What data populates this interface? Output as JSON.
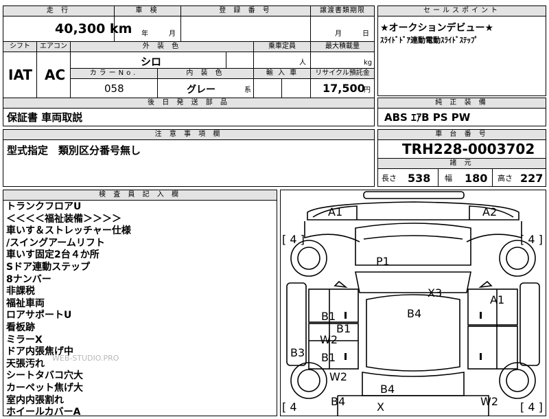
{
  "top_left": {
    "headers": {
      "mileage": "走 行",
      "inspection": "車 検",
      "registration": "登 録 番 号",
      "transfer_deadline": "譲渡書類期限",
      "shift": "シフト",
      "aircon": "エアコン",
      "exterior_color": "外 装 色",
      "capacity": "乗車定員",
      "max_load": "最大積載量",
      "color_no": "カラーNo.",
      "interior_color": "内 装 色",
      "import": "輸 入 車",
      "recycle": "リサイクル預託金",
      "later_parts": "後 日 発 送 部 品",
      "notes": "注 意 事 項 欄"
    },
    "mileage_value": "40,300 km",
    "inspection_year": "年",
    "inspection_month": "月",
    "transfer_month": "月",
    "transfer_day": "日",
    "shift_value": "IAT",
    "aircon_value": "AC",
    "exterior_color_value": "シロ",
    "capacity_unit": "人",
    "max_load_unit": "kg",
    "color_no_value": "058",
    "interior_color_value": "グレー",
    "interior_suffix": "系",
    "recycle_value": "17,500",
    "recycle_unit": "円",
    "later_parts_value": "保証書 車両取説",
    "notes_value": "型式指定　類別区分番号無し"
  },
  "top_right": {
    "sales_point_header": "セールスポイント",
    "sales_point_1": "★オークションデビュー★",
    "sales_point_2": "ｽﾗｲﾄﾞﾄﾞｱ連動電動ｽﾗｲﾄﾞｽﾃｯﾌﾟ",
    "equipment_header": "純 正 装 備",
    "equipment_value": "ABS ｴｱB PS PW",
    "chassis_header": "車 台 番 号",
    "chassis_value": "TRH228-0003702",
    "dimensions_header": "諸 元",
    "length_label": "長さ",
    "length_value": "538",
    "width_label": "幅",
    "width_value": "180",
    "height_label": "高さ",
    "height_value": "227"
  },
  "inspector": {
    "header": "検 査 員 記 入 欄",
    "lines": [
      "トランクフロアU",
      "＜＜＜＜福祉装備＞＞＞＞",
      "車いす＆ストレッチャー仕様",
      "/スイングアームリフト",
      "車いす固定2台４か所",
      "Sドア連動ステップ",
      "8ナンバー",
      "非課税",
      "福祉車両",
      "ロアサポートU",
      "看板跡",
      "ミラーX",
      "ドア内張焦げ中",
      "天張汚れ",
      "シートタバコ穴大",
      "カーペット焦げ大",
      "室内内張割れ",
      "ホイールカバーA"
    ],
    "watermark": "WEB-STUDIO.PRO"
  },
  "diagram": {
    "tire_labels": [
      "[ 4 ]",
      "[ 4 ]",
      "[ 4",
      "[ 4 ]"
    ],
    "marks": {
      "a1_front_left": "A1",
      "a2_front_right": "A2",
      "p1_hood": "P1",
      "x3_windshield": "X3",
      "a1_right_door": "A1",
      "b4_roof": "B4",
      "b1_left_1": "B1",
      "b1_left_2": "B1",
      "w2_left_1": "W2",
      "b3_left_panel": "B3",
      "b1_left_3": "B1",
      "w2_left_2": "W2",
      "b4_rear_left": "B4",
      "b4_rear": "B4",
      "x_rear": "X",
      "w2_rear_right": "W2"
    }
  }
}
